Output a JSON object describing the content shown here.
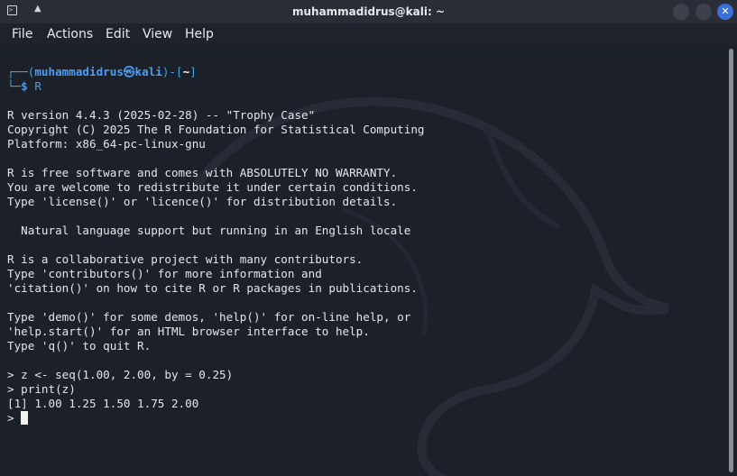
{
  "window": {
    "title": "muhammadidrus@kali: ~",
    "terminal_icon": "terminal-icon",
    "pin_icon": "chevron-up-icon",
    "buttons": [
      "minimize-icon",
      "maximize-icon",
      "close-icon"
    ],
    "close_glyph": "✕"
  },
  "menu": {
    "items": [
      "File",
      "Actions",
      "Edit",
      "View",
      "Help"
    ]
  },
  "prompt": {
    "corner_top": "┌──(",
    "user_host": "muhammadidrus㉿kali",
    "mid": ")-[",
    "dir": "~",
    "end": "]",
    "corner_bottom": "└─",
    "dollar": "$",
    "command": "R"
  },
  "output": {
    "l1": "R version 4.4.3 (2025-02-28) -- \"Trophy Case\"",
    "l2": "Copyright (C) 2025 The R Foundation for Statistical Computing",
    "l3": "Platform: x86_64-pc-linux-gnu",
    "l4": "R is free software and comes with ABSOLUTELY NO WARRANTY.",
    "l5": "You are welcome to redistribute it under certain conditions.",
    "l6": "Type 'license()' or 'licence()' for distribution details.",
    "l7": "  Natural language support but running in an English locale",
    "l8": "R is a collaborative project with many contributors.",
    "l9": "Type 'contributors()' for more information and",
    "l10": "'citation()' on how to cite R or R packages in publications.",
    "l11": "Type 'demo()' for some demos, 'help()' for on-line help, or",
    "l12": "'help.start()' for an HTML browser interface to help.",
    "l13": "Type 'q()' to quit R.",
    "l14": "> z <- seq(1.00, 2.00, by = 0.25)",
    "l15": "> print(z)",
    "l16": "[1] 1.00 1.25 1.50 1.75 2.00",
    "l17": "> "
  },
  "colors": {
    "accent": "#3a6ed8",
    "prompt": "#3fa2e8",
    "background": "#1c2029"
  }
}
